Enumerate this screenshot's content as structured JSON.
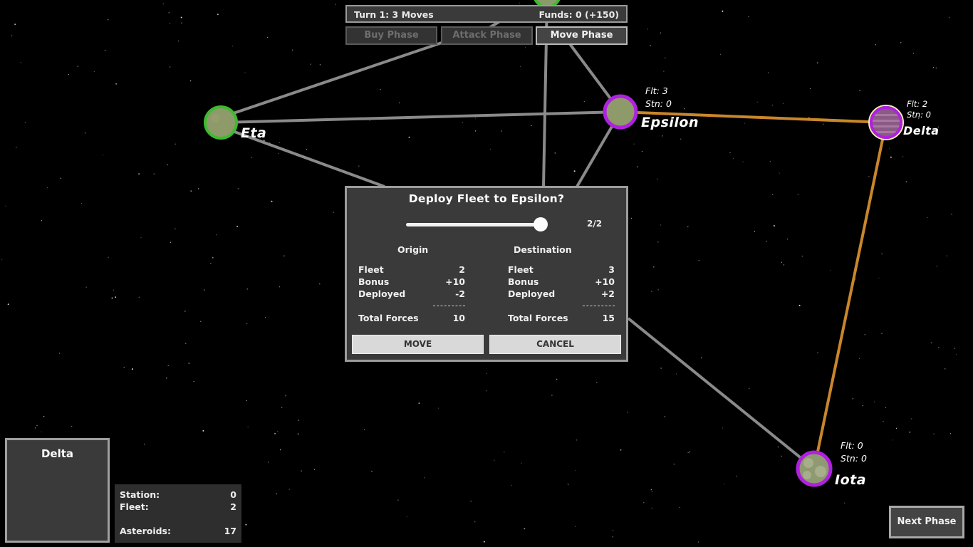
{
  "topbar": {
    "turn_text": "Turn 1: 3 Moves",
    "funds_text": "Funds: 0 (+150)"
  },
  "phases": [
    {
      "label": "Buy Phase",
      "active": false
    },
    {
      "label": "Attack Phase",
      "active": false
    },
    {
      "label": "Move Phase",
      "active": true
    }
  ],
  "planets": {
    "eta": {
      "name": "Eta",
      "owner_color": "#3dbb2f"
    },
    "epsilon": {
      "name": "Epsilon",
      "fleet": "Flt: 3",
      "station": "Stn: 0",
      "owner_color": "#b020e0"
    },
    "delta": {
      "name": "Delta",
      "fleet": "Flt: 2",
      "station": "Stn: 0",
      "owner_color": "#b020e0",
      "selected_color": "#f2f0b0"
    },
    "iota": {
      "name": "Iota",
      "fleet": "Flt: 0",
      "station": "Stn: 0",
      "owner_color": "#b020e0"
    }
  },
  "route_colors": {
    "normal": "#8a8a8a",
    "selected": "#c9862a"
  },
  "dialog": {
    "title": "Deploy Fleet to Epsilon?",
    "slider_value_text": "2/2",
    "slider_fraction": 1.0,
    "origin": {
      "header": "Origin",
      "rows": [
        {
          "label": "Fleet",
          "value": "2"
        },
        {
          "label": "Bonus",
          "value": "+10"
        },
        {
          "label": "Deployed",
          "value": "-2"
        }
      ],
      "total_label": "Total Forces",
      "total_value": "10"
    },
    "destination": {
      "header": "Destination",
      "rows": [
        {
          "label": "Fleet",
          "value": "3"
        },
        {
          "label": "Bonus",
          "value": "+10"
        },
        {
          "label": "Deployed",
          "value": "+2"
        }
      ],
      "total_label": "Total Forces",
      "total_value": "15"
    },
    "move_label": "MOVE",
    "cancel_label": "CANCEL"
  },
  "selected_planet": {
    "name": "Delta",
    "station_label": "Station:",
    "station_value": "0",
    "fleet_label": "Fleet:",
    "fleet_value": "2",
    "asteroids_label": "Asteroids:",
    "asteroids_value": "17"
  },
  "next_phase_label": "Next Phase"
}
